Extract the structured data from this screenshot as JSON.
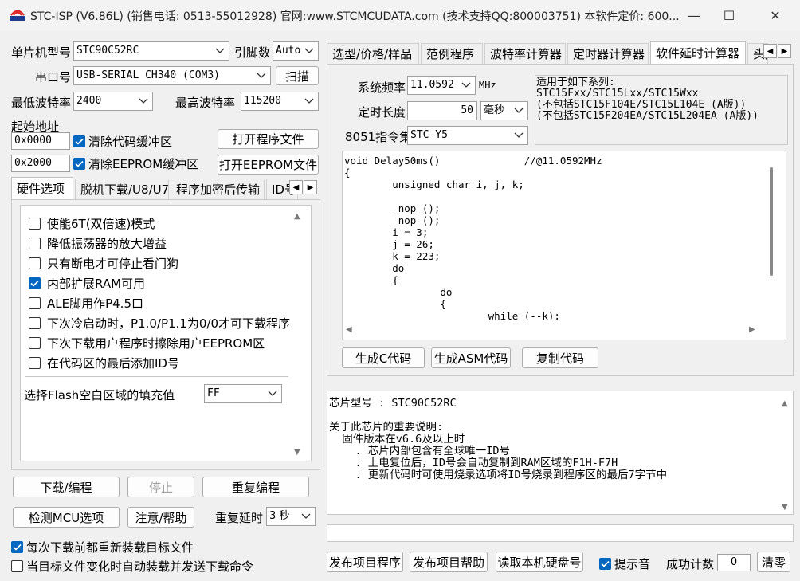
{
  "window": {
    "title": "STC-ISP (V6.86L) (销售电话: 0513-55012928) 官网:www.STCMCUDATA.com  (技术支持QQ:800003751) 本软件定价: 600...",
    "min_glyph": "—",
    "max_glyph": "☐",
    "close_glyph": "✕"
  },
  "left": {
    "mcu_label": "单片机型号",
    "mcu_value": "STC90C52RC",
    "pin_label": "引脚数",
    "pin_value": "Auto",
    "port_label": "串口号",
    "port_value": "USB-SERIAL CH340 (COM3)",
    "scan_button": "扫描",
    "min_baud_label": "最低波特率",
    "min_baud_value": "2400",
    "max_baud_label": "最高波特率",
    "max_baud_value": "115200",
    "start_addr_label": "起始地址",
    "addr1": "0x0000",
    "clear_code_label": "清除代码缓冲区",
    "open_program_button": "打开程序文件",
    "addr2": "0x2000",
    "clear_eeprom_label": "清除EEPROM缓冲区",
    "open_eeprom_button": "打开EEPROM文件",
    "tabs": [
      "硬件选项",
      "脱机下载/U8/U7",
      "程序加密后传输",
      "ID号"
    ],
    "options": [
      {
        "label": "使能6T(双倍速)模式",
        "checked": false
      },
      {
        "label": "降低振荡器的放大增益",
        "checked": false
      },
      {
        "label": "只有断电才可停止看门狗",
        "checked": false
      },
      {
        "label": "内部扩展RAM可用",
        "checked": true
      },
      {
        "label": "ALE脚用作P4.5口",
        "checked": false
      },
      {
        "label": "下次冷启动时，P1.0/P1.1为0/0才可下载程序",
        "checked": false
      },
      {
        "label": "下次下载用户程序时擦除用户EEPROM区",
        "checked": false
      },
      {
        "label": "在代码区的最后添加ID号",
        "checked": false
      }
    ],
    "fill_label": "选择Flash空白区域的填充值",
    "fill_value": "FF",
    "download_button": "下载/编程",
    "stop_button": "停止",
    "reprogram_button": "重复编程",
    "detect_button": "检测MCU选项",
    "help_button": "注意/帮助",
    "repeat_delay_label": "重复延时",
    "repeat_delay_value": "3 秒",
    "reload_label": "每次下载前都重新装载目标文件",
    "auto_reload_label": "当目标文件变化时自动装载并发送下载命令"
  },
  "right": {
    "tabs": [
      "选型/价格/样品",
      "范例程序",
      "波特率计算器",
      "定时器计算器",
      "软件延时计算器",
      "头文件"
    ],
    "freq_label": "系统频率",
    "freq_value": "11.0592",
    "freq_unit": "MHz",
    "delay_label": "定时长度",
    "delay_value": "50",
    "delay_unit": "毫秒",
    "isa_label": "8051指令集",
    "isa_value": "STC-Y5",
    "applies_title": "适用于如下系列:",
    "applies_lines": [
      "STC15Fxx/STC15Lxx/STC15Wxx",
      "(不包括STC15F104E/STC15L104E (A版))",
      "(不包括STC15F204EA/STC15L204EA (A版))"
    ],
    "code": "void Delay50ms()              //@11.0592MHz\n{\n        unsigned char i, j, k;\n\n        _nop_();\n        _nop_();\n        i = 3;\n        j = 26;\n        k = 223;\n        do\n        {\n                do\n                {\n                        while (--k);",
    "gen_c_button": "生成C代码",
    "gen_asm_button": "生成ASM代码",
    "copy_button": "复制代码",
    "info_lines": [
      "芯片型号 : STC90C52RC",
      "",
      "关于此芯片的重要说明:",
      "  固件版本在v6.6及以上时",
      "    . 芯片内部包含有全球唯一ID号",
      "    . 上电复位后，ID号会自动复制到RAM区域的F1H-F7H",
      "    . 更新代码时可使用烧录选项将ID号烧录到程序区的最后7字节中"
    ],
    "publish_button": "发布项目程序",
    "publish_help_button": "发布项目帮助",
    "read_disk_button": "读取本机硬盘号",
    "beep_label": "提示音",
    "count_label": "成功计数",
    "count_value": "0",
    "clear_button": "清零"
  },
  "colors": {
    "accent": "#0067c0"
  }
}
